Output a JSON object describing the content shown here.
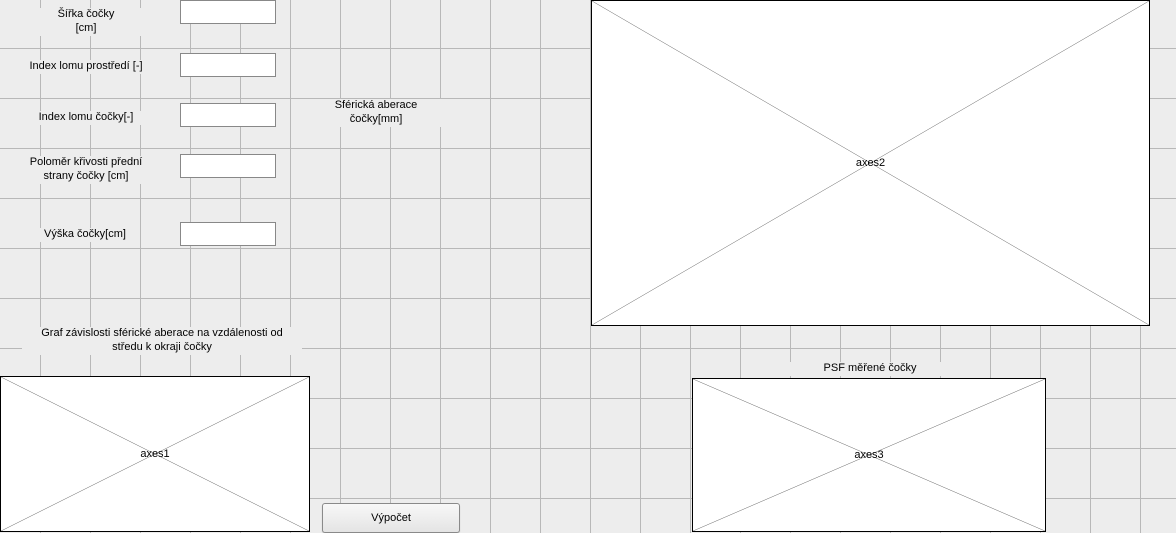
{
  "labels": {
    "sirka_cocky": "Šířka čočky\n[cm]",
    "index_prostredi": "Index lomu prostředí [-]",
    "index_cocky": "Index  lomu čočky[-]",
    "polomer": "Poloměr křivosti přední\nstrany čočky [cm]",
    "vyska": "Výška čočky[cm]",
    "sferab": "Sférická aberace\nčočky[mm]",
    "graf": "Graf závislosti sférické aberace na vzdálenosti od\nstředu k okraji čočky",
    "psf": "PSF měřené čočky"
  },
  "inputs": {
    "sirka_cocky": "",
    "index_prostredi": "",
    "index_cocky": "",
    "polomer": "",
    "vyska": ""
  },
  "axes": {
    "axes1": "axes1",
    "axes2": "axes2",
    "axes3": "axes3"
  },
  "buttons": {
    "vypocet": "Výpočet"
  }
}
